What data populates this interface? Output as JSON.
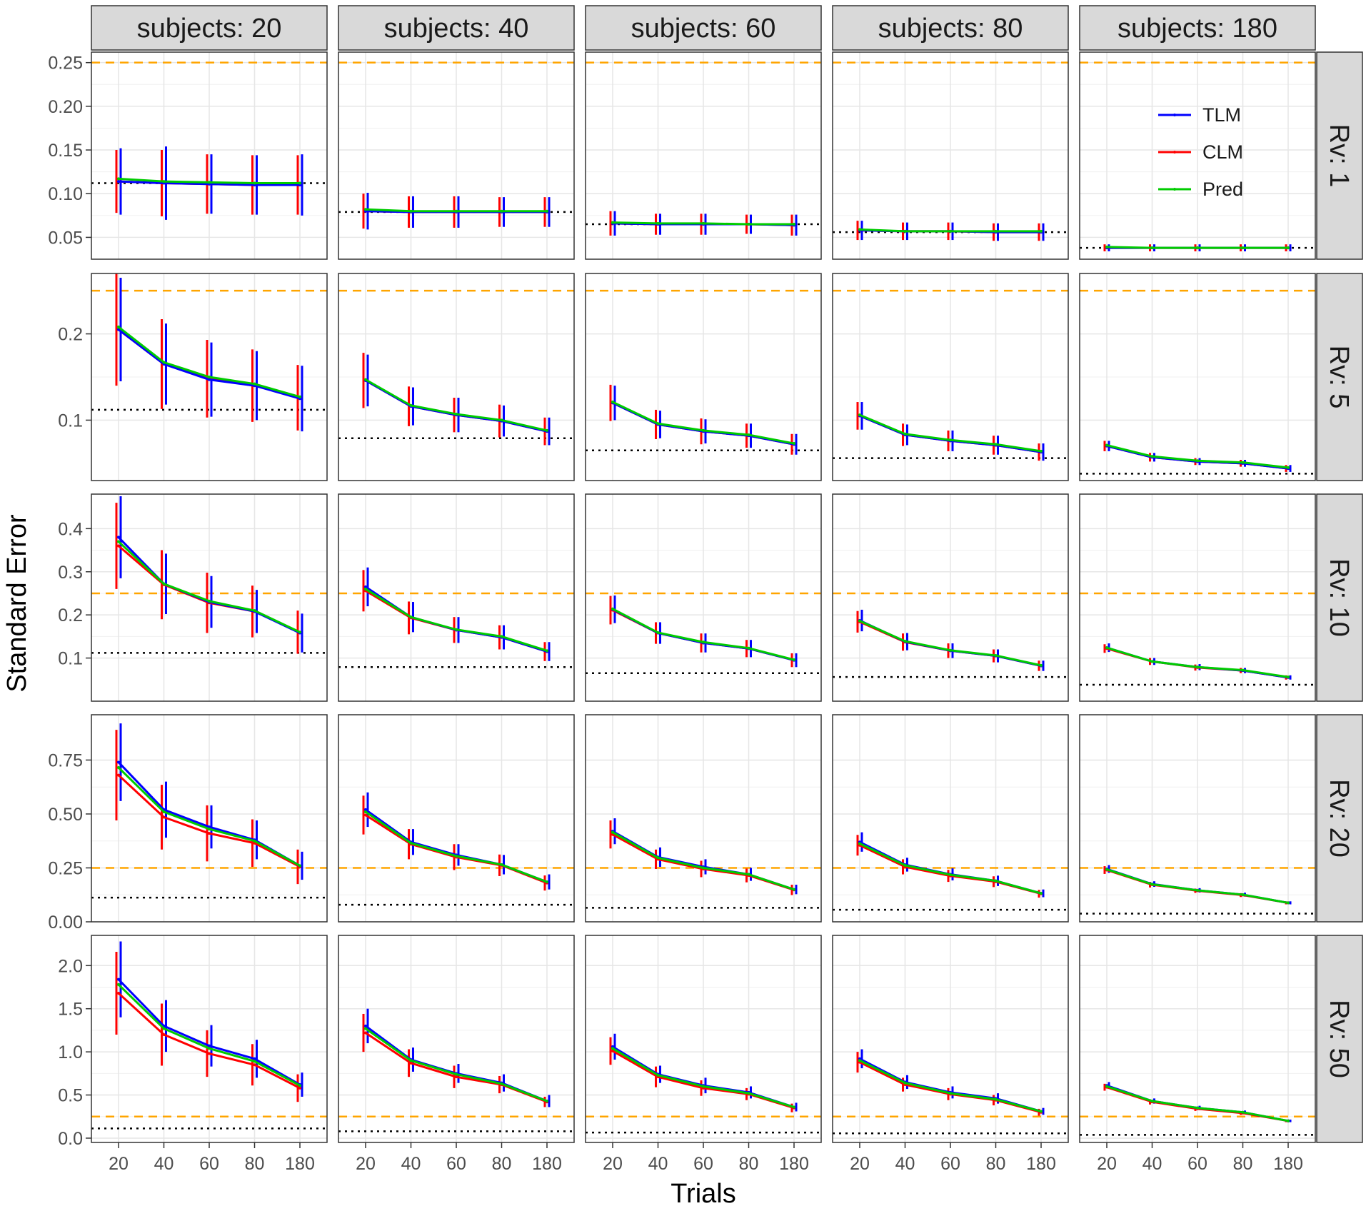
{
  "chart_data": {
    "type": "line",
    "title": "",
    "xlabel": "Trials",
    "ylabel": "Standard Error",
    "x_categories": [
      "20",
      "40",
      "60",
      "80",
      "180"
    ],
    "columns": [
      {
        "label": "subjects: 20"
      },
      {
        "label": "subjects: 40"
      },
      {
        "label": "subjects: 60"
      },
      {
        "label": "subjects: 80"
      },
      {
        "label": "subjects: 180"
      }
    ],
    "rows": [
      {
        "label": "Rv: 1",
        "ylim": [
          0.025,
          0.262
        ],
        "yticks": [
          0.05,
          0.1,
          0.15,
          0.2,
          0.25
        ],
        "ytick_labels": [
          "0.05",
          "0.10",
          "0.15",
          "0.20",
          "0.25"
        ]
      },
      {
        "label": "Rv: 5",
        "ylim": [
          0.03,
          0.27
        ],
        "yticks": [
          0.1,
          0.2
        ],
        "ytick_labels": [
          "0.1",
          "0.2"
        ]
      },
      {
        "label": "Rv: 10",
        "ylim": [
          0.0,
          0.48
        ],
        "yticks": [
          0.1,
          0.2,
          0.3,
          0.4
        ],
        "ytick_labels": [
          "0.1",
          "0.2",
          "0.3",
          "0.4"
        ]
      },
      {
        "label": "Rv: 20",
        "ylim": [
          0.0,
          0.96
        ],
        "yticks": [
          0.0,
          0.25,
          0.5,
          0.75
        ],
        "ytick_labels": [
          "0.00",
          "0.25",
          "0.50",
          "0.75"
        ]
      },
      {
        "label": "Rv: 50",
        "ylim": [
          -0.05,
          2.35
        ],
        "yticks": [
          0.0,
          0.5,
          1.0,
          1.5,
          2.0
        ],
        "ytick_labels": [
          "0.0",
          "0.5",
          "1.0",
          "1.5",
          "2.0"
        ]
      }
    ],
    "reference_lines": {
      "orange_dashed": {
        "value": 0.25,
        "color": "#FFA500"
      },
      "black_dotted": {
        "values_by_subjects": [
          0.112,
          0.079,
          0.065,
          0.056,
          0.038
        ],
        "color": "#000000"
      }
    },
    "legend": {
      "position": "inside top-right (subjects: 180, Rv: 1 panel)",
      "entries": [
        {
          "name": "TLM",
          "color": "#0000FF"
        },
        {
          "name": "CLM",
          "color": "#FF0000"
        },
        {
          "name": "Pred",
          "color": "#00CC00"
        }
      ]
    },
    "series": [
      {
        "name": "TLM",
        "color": "#0000FF",
        "panels": [
          [
            [
              0.114,
              0.112,
              0.111,
              0.11,
              0.11
            ],
            [
              0.08,
              0.079,
              0.079,
              0.079,
              0.079
            ],
            [
              0.066,
              0.065,
              0.065,
              0.065,
              0.064
            ],
            [
              0.058,
              0.057,
              0.057,
              0.056,
              0.056
            ],
            [
              0.038,
              0.038,
              0.038,
              0.038,
              0.038
            ]
          ],
          [
            [
              0.205,
              0.165,
              0.147,
              0.14,
              0.125
            ],
            [
              0.146,
              0.116,
              0.106,
              0.099,
              0.087
            ],
            [
              0.12,
              0.095,
              0.087,
              0.082,
              0.072
            ],
            [
              0.105,
              0.083,
              0.076,
              0.071,
              0.063
            ],
            [
              0.07,
              0.057,
              0.052,
              0.05,
              0.044
            ]
          ],
          [
            [
              0.38,
              0.272,
              0.23,
              0.208,
              0.158
            ],
            [
              0.265,
              0.195,
              0.165,
              0.148,
              0.115
            ],
            [
              0.213,
              0.158,
              0.135,
              0.122,
              0.095
            ],
            [
              0.187,
              0.138,
              0.117,
              0.105,
              0.082
            ],
            [
              0.124,
              0.092,
              0.079,
              0.071,
              0.055
            ]
          ],
          [
            [
              0.74,
              0.52,
              0.44,
              0.38,
              0.26
            ],
            [
              0.52,
              0.37,
              0.31,
              0.265,
              0.185
            ],
            [
              0.42,
              0.3,
              0.255,
              0.22,
              0.15
            ],
            [
              0.37,
              0.265,
              0.22,
              0.19,
              0.132
            ],
            [
              0.245,
              0.175,
              0.146,
              0.126,
              0.088
            ]
          ],
          [
            [
              1.84,
              1.3,
              1.07,
              0.92,
              0.62
            ],
            [
              1.3,
              0.91,
              0.75,
              0.64,
              0.43
            ],
            [
              1.06,
              0.74,
              0.61,
              0.53,
              0.36
            ],
            [
              0.92,
              0.65,
              0.53,
              0.46,
              0.31
            ],
            [
              0.61,
              0.43,
              0.35,
              0.3,
              0.2
            ]
          ]
        ]
      },
      {
        "name": "CLM",
        "color": "#FF0000",
        "panels": [
          [
            [
              0.114,
              0.112,
              0.111,
              0.11,
              0.11
            ],
            [
              0.08,
              0.079,
              0.079,
              0.079,
              0.079
            ],
            [
              0.066,
              0.065,
              0.065,
              0.065,
              0.064
            ],
            [
              0.058,
              0.057,
              0.057,
              0.056,
              0.056
            ],
            [
              0.038,
              0.038,
              0.038,
              0.038,
              0.038
            ]
          ],
          [
            [
              0.205,
              0.165,
              0.148,
              0.14,
              0.126
            ],
            [
              0.146,
              0.116,
              0.106,
              0.099,
              0.087
            ],
            [
              0.12,
              0.095,
              0.087,
              0.082,
              0.072
            ],
            [
              0.105,
              0.083,
              0.076,
              0.071,
              0.063
            ],
            [
              0.07,
              0.057,
              0.052,
              0.05,
              0.044
            ]
          ],
          [
            [
              0.36,
              0.27,
              0.228,
              0.208,
              0.16
            ],
            [
              0.256,
              0.193,
              0.165,
              0.148,
              0.115
            ],
            [
              0.211,
              0.158,
              0.135,
              0.122,
              0.095
            ],
            [
              0.184,
              0.137,
              0.117,
              0.105,
              0.082
            ],
            [
              0.122,
              0.092,
              0.078,
              0.071,
              0.055
            ]
          ],
          [
            [
              0.68,
              0.485,
              0.41,
              0.365,
              0.255
            ],
            [
              0.495,
              0.36,
              0.3,
              0.262,
              0.18
            ],
            [
              0.405,
              0.29,
              0.245,
              0.215,
              0.148
            ],
            [
              0.355,
              0.255,
              0.213,
              0.186,
              0.13
            ],
            [
              0.24,
              0.172,
              0.144,
              0.124,
              0.088
            ]
          ],
          [
            [
              1.68,
              1.2,
              0.98,
              0.85,
              0.58
            ],
            [
              1.22,
              0.87,
              0.71,
              0.62,
              0.42
            ],
            [
              1.01,
              0.71,
              0.58,
              0.51,
              0.35
            ],
            [
              0.88,
              0.62,
              0.51,
              0.44,
              0.3
            ],
            [
              0.59,
              0.42,
              0.34,
              0.29,
              0.2
            ]
          ]
        ]
      },
      {
        "name": "Pred",
        "color": "#00CC00",
        "panels": [
          [
            [
              0.117,
              0.114,
              0.113,
              0.112,
              0.112
            ],
            [
              0.082,
              0.08,
              0.08,
              0.08,
              0.08
            ],
            [
              0.067,
              0.066,
              0.066,
              0.065,
              0.065
            ],
            [
              0.059,
              0.057,
              0.057,
              0.057,
              0.057
            ],
            [
              0.039,
              0.038,
              0.038,
              0.038,
              0.038
            ]
          ],
          [
            [
              0.208,
              0.167,
              0.15,
              0.142,
              0.127
            ],
            [
              0.147,
              0.117,
              0.107,
              0.1,
              0.088
            ],
            [
              0.121,
              0.096,
              0.088,
              0.083,
              0.073
            ],
            [
              0.106,
              0.084,
              0.077,
              0.072,
              0.064
            ],
            [
              0.071,
              0.058,
              0.053,
              0.051,
              0.045
            ]
          ],
          [
            [
              0.37,
              0.272,
              0.232,
              0.21,
              0.16
            ],
            [
              0.26,
              0.195,
              0.166,
              0.15,
              0.117
            ],
            [
              0.214,
              0.159,
              0.137,
              0.123,
              0.096
            ],
            [
              0.186,
              0.139,
              0.118,
              0.106,
              0.083
            ],
            [
              0.124,
              0.092,
              0.079,
              0.072,
              0.056
            ]
          ],
          [
            [
              0.715,
              0.51,
              0.43,
              0.375,
              0.26
            ],
            [
              0.51,
              0.365,
              0.305,
              0.265,
              0.185
            ],
            [
              0.415,
              0.297,
              0.25,
              0.22,
              0.15
            ],
            [
              0.363,
              0.262,
              0.218,
              0.19,
              0.132
            ],
            [
              0.243,
              0.174,
              0.146,
              0.126,
              0.088
            ]
          ],
          [
            [
              1.78,
              1.27,
              1.04,
              0.89,
              0.61
            ],
            [
              1.27,
              0.9,
              0.74,
              0.63,
              0.43
            ],
            [
              1.04,
              0.73,
              0.6,
              0.52,
              0.36
            ],
            [
              0.9,
              0.64,
              0.52,
              0.45,
              0.31
            ],
            [
              0.6,
              0.43,
              0.35,
              0.3,
              0.2
            ]
          ]
        ]
      }
    ],
    "error_bar_half_width": {
      "TLM": [
        [
          [
            0.038,
            0.042,
            0.034,
            0.034,
            0.035
          ],
          [
            0.021,
            0.018,
            0.018,
            0.017,
            0.017
          ],
          [
            0.014,
            0.012,
            0.012,
            0.011,
            0.012
          ],
          [
            0.011,
            0.01,
            0.01,
            0.01,
            0.01
          ],
          [
            0.004,
            0.004,
            0.004,
            0.004,
            0.004
          ]
        ],
        [
          [
            0.06,
            0.047,
            0.043,
            0.04,
            0.038
          ],
          [
            0.03,
            0.022,
            0.02,
            0.018,
            0.016
          ],
          [
            0.02,
            0.016,
            0.014,
            0.014,
            0.012
          ],
          [
            0.016,
            0.012,
            0.012,
            0.011,
            0.01
          ],
          [
            0.006,
            0.005,
            0.004,
            0.004,
            0.004
          ]
        ],
        [
          [
            0.095,
            0.07,
            0.06,
            0.05,
            0.045
          ],
          [
            0.045,
            0.035,
            0.03,
            0.028,
            0.022
          ],
          [
            0.032,
            0.025,
            0.022,
            0.02,
            0.016
          ],
          [
            0.025,
            0.02,
            0.017,
            0.015,
            0.012
          ],
          [
            0.01,
            0.008,
            0.007,
            0.006,
            0.005
          ]
        ],
        [
          [
            0.18,
            0.13,
            0.1,
            0.09,
            0.065
          ],
          [
            0.08,
            0.06,
            0.05,
            0.045,
            0.035
          ],
          [
            0.06,
            0.045,
            0.035,
            0.03,
            0.022
          ],
          [
            0.045,
            0.032,
            0.028,
            0.024,
            0.018
          ],
          [
            0.018,
            0.013,
            0.01,
            0.009,
            0.007
          ]
        ],
        [
          [
            0.44,
            0.3,
            0.24,
            0.22,
            0.14
          ],
          [
            0.2,
            0.14,
            0.11,
            0.1,
            0.07
          ],
          [
            0.15,
            0.1,
            0.09,
            0.07,
            0.05
          ],
          [
            0.11,
            0.08,
            0.07,
            0.06,
            0.04
          ],
          [
            0.04,
            0.03,
            0.025,
            0.02,
            0.015
          ]
        ]
      ],
      "CLM": [
        [
          [
            0.036,
            0.038,
            0.034,
            0.034,
            0.034
          ],
          [
            0.02,
            0.018,
            0.018,
            0.017,
            0.017
          ],
          [
            0.014,
            0.012,
            0.012,
            0.011,
            0.012
          ],
          [
            0.011,
            0.01,
            0.01,
            0.01,
            0.01
          ],
          [
            0.004,
            0.004,
            0.004,
            0.004,
            0.004
          ]
        ],
        [
          [
            0.065,
            0.052,
            0.045,
            0.042,
            0.038
          ],
          [
            0.032,
            0.023,
            0.02,
            0.019,
            0.016
          ],
          [
            0.021,
            0.017,
            0.015,
            0.014,
            0.012
          ],
          [
            0.016,
            0.013,
            0.012,
            0.011,
            0.01
          ],
          [
            0.006,
            0.005,
            0.004,
            0.004,
            0.004
          ]
        ],
        [
          [
            0.1,
            0.08,
            0.07,
            0.06,
            0.05
          ],
          [
            0.048,
            0.038,
            0.03,
            0.028,
            0.022
          ],
          [
            0.033,
            0.025,
            0.022,
            0.02,
            0.016
          ],
          [
            0.025,
            0.02,
            0.017,
            0.015,
            0.012
          ],
          [
            0.01,
            0.008,
            0.007,
            0.006,
            0.005
          ]
        ],
        [
          [
            0.21,
            0.15,
            0.13,
            0.11,
            0.08
          ],
          [
            0.09,
            0.07,
            0.06,
            0.05,
            0.035
          ],
          [
            0.065,
            0.045,
            0.038,
            0.032,
            0.024
          ],
          [
            0.048,
            0.035,
            0.028,
            0.025,
            0.018
          ],
          [
            0.018,
            0.013,
            0.01,
            0.009,
            0.007
          ]
        ],
        [
          [
            0.48,
            0.36,
            0.27,
            0.24,
            0.16
          ],
          [
            0.22,
            0.16,
            0.13,
            0.1,
            0.06
          ],
          [
            0.16,
            0.12,
            0.09,
            0.07,
            0.05
          ],
          [
            0.12,
            0.08,
            0.07,
            0.06,
            0.04
          ],
          [
            0.04,
            0.03,
            0.025,
            0.02,
            0.015
          ]
        ]
      ]
    }
  }
}
